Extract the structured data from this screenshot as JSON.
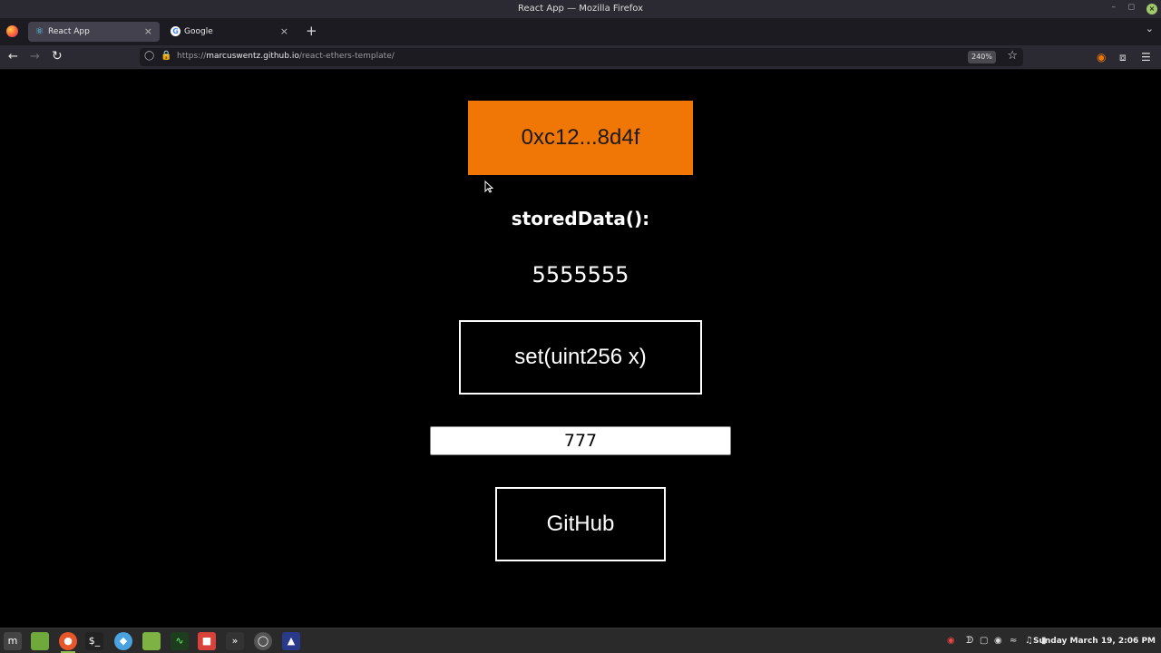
{
  "window": {
    "title": "React App — Mozilla Firefox"
  },
  "tabs": [
    {
      "label": "React App",
      "icon": "react-icon",
      "active": true
    },
    {
      "label": "Google",
      "icon": "google-icon",
      "active": false
    }
  ],
  "navbar": {
    "url_scheme": "https://",
    "url_host": "marcuswentz.github.io",
    "url_path": "/react-ethers-template/",
    "zoom": "240%"
  },
  "page": {
    "account_label": "0xc12...8d4f",
    "stored_label": "storedData():",
    "stored_value": "5555555",
    "set_label": "set(uint256 x)",
    "input_value": "777",
    "github_label": "GitHub"
  },
  "colors": {
    "accent": "#f07605",
    "background": "#000000"
  },
  "taskbar": {
    "clock": "Sunday March 19, 2:06 PM"
  }
}
